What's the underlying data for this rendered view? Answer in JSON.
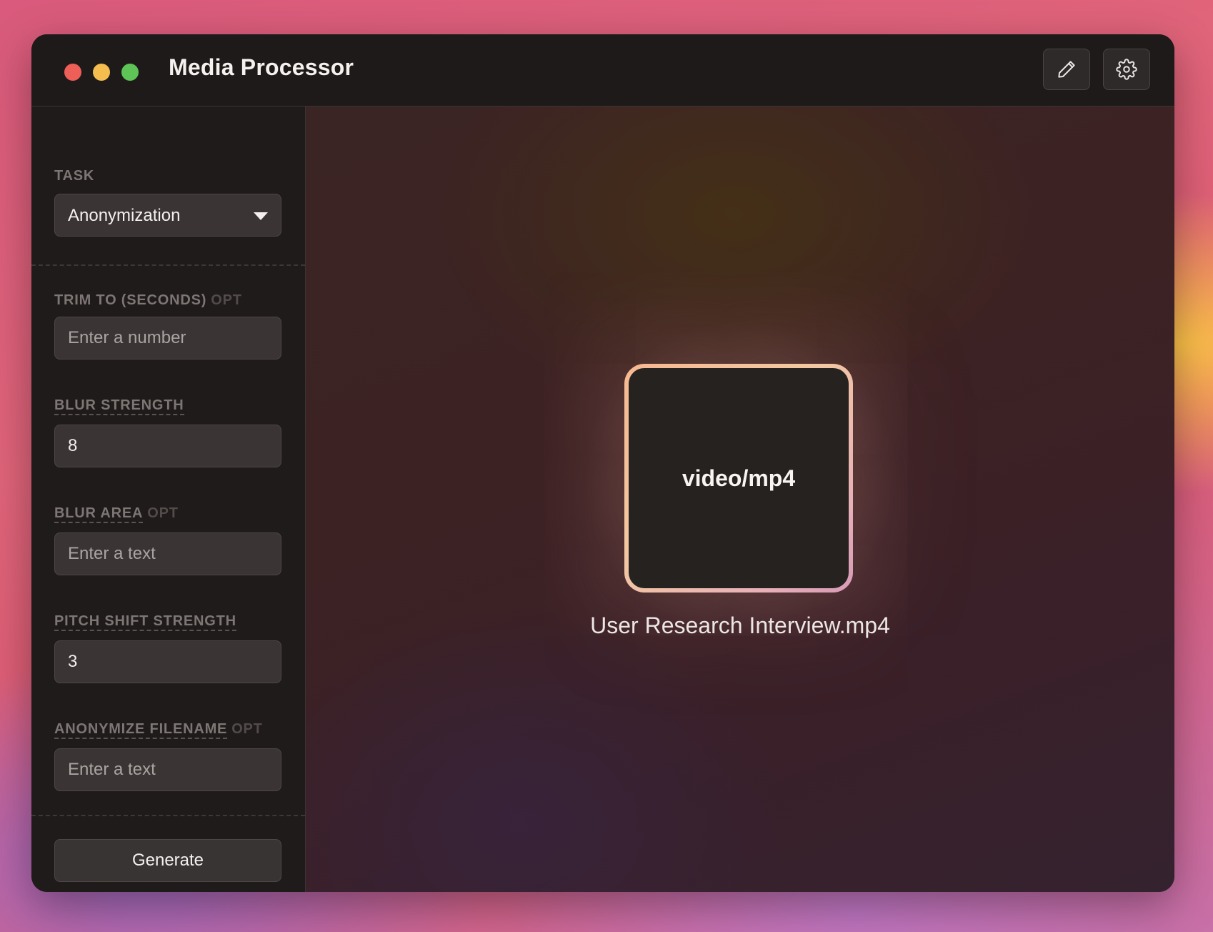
{
  "window": {
    "title": "Media Processor",
    "controls": [
      "close",
      "minimize",
      "zoom"
    ],
    "toolbar": [
      {
        "name": "edit",
        "icon": "pencil-icon"
      },
      {
        "name": "settings",
        "icon": "gear-icon"
      }
    ]
  },
  "sidebar": {
    "task": {
      "label": "TASK",
      "selected": "Anonymization"
    },
    "fields": {
      "trim": {
        "label": "TRIM TO (SECONDS)",
        "optional": "OPT",
        "value": "",
        "placeholder": "Enter a number"
      },
      "blur_strength": {
        "label": "BLUR STRENGTH",
        "value": "8",
        "placeholder": ""
      },
      "blur_area": {
        "label": "BLUR AREA",
        "optional": "OPT",
        "value": "",
        "placeholder": "Enter a text"
      },
      "pitch_shift": {
        "label": "PITCH SHIFT STRENGTH",
        "value": "3",
        "placeholder": ""
      },
      "anonymize_filename": {
        "label": "ANONYMIZE FILENAME",
        "optional": "OPT",
        "value": "",
        "placeholder": "Enter a text"
      }
    },
    "generate_label": "Generate"
  },
  "preview": {
    "file_type": "video/mp4",
    "file_name": "User Research Interview.mp4"
  },
  "colors": {
    "window_bg": "#1e1a1a",
    "input_bg": "#3a3534",
    "accent_gradient_start": "#f6b892",
    "accent_gradient_end": "#d79ab6",
    "close": "#ee5f57",
    "minimize": "#f5bd4f",
    "zoom": "#5ec456"
  }
}
